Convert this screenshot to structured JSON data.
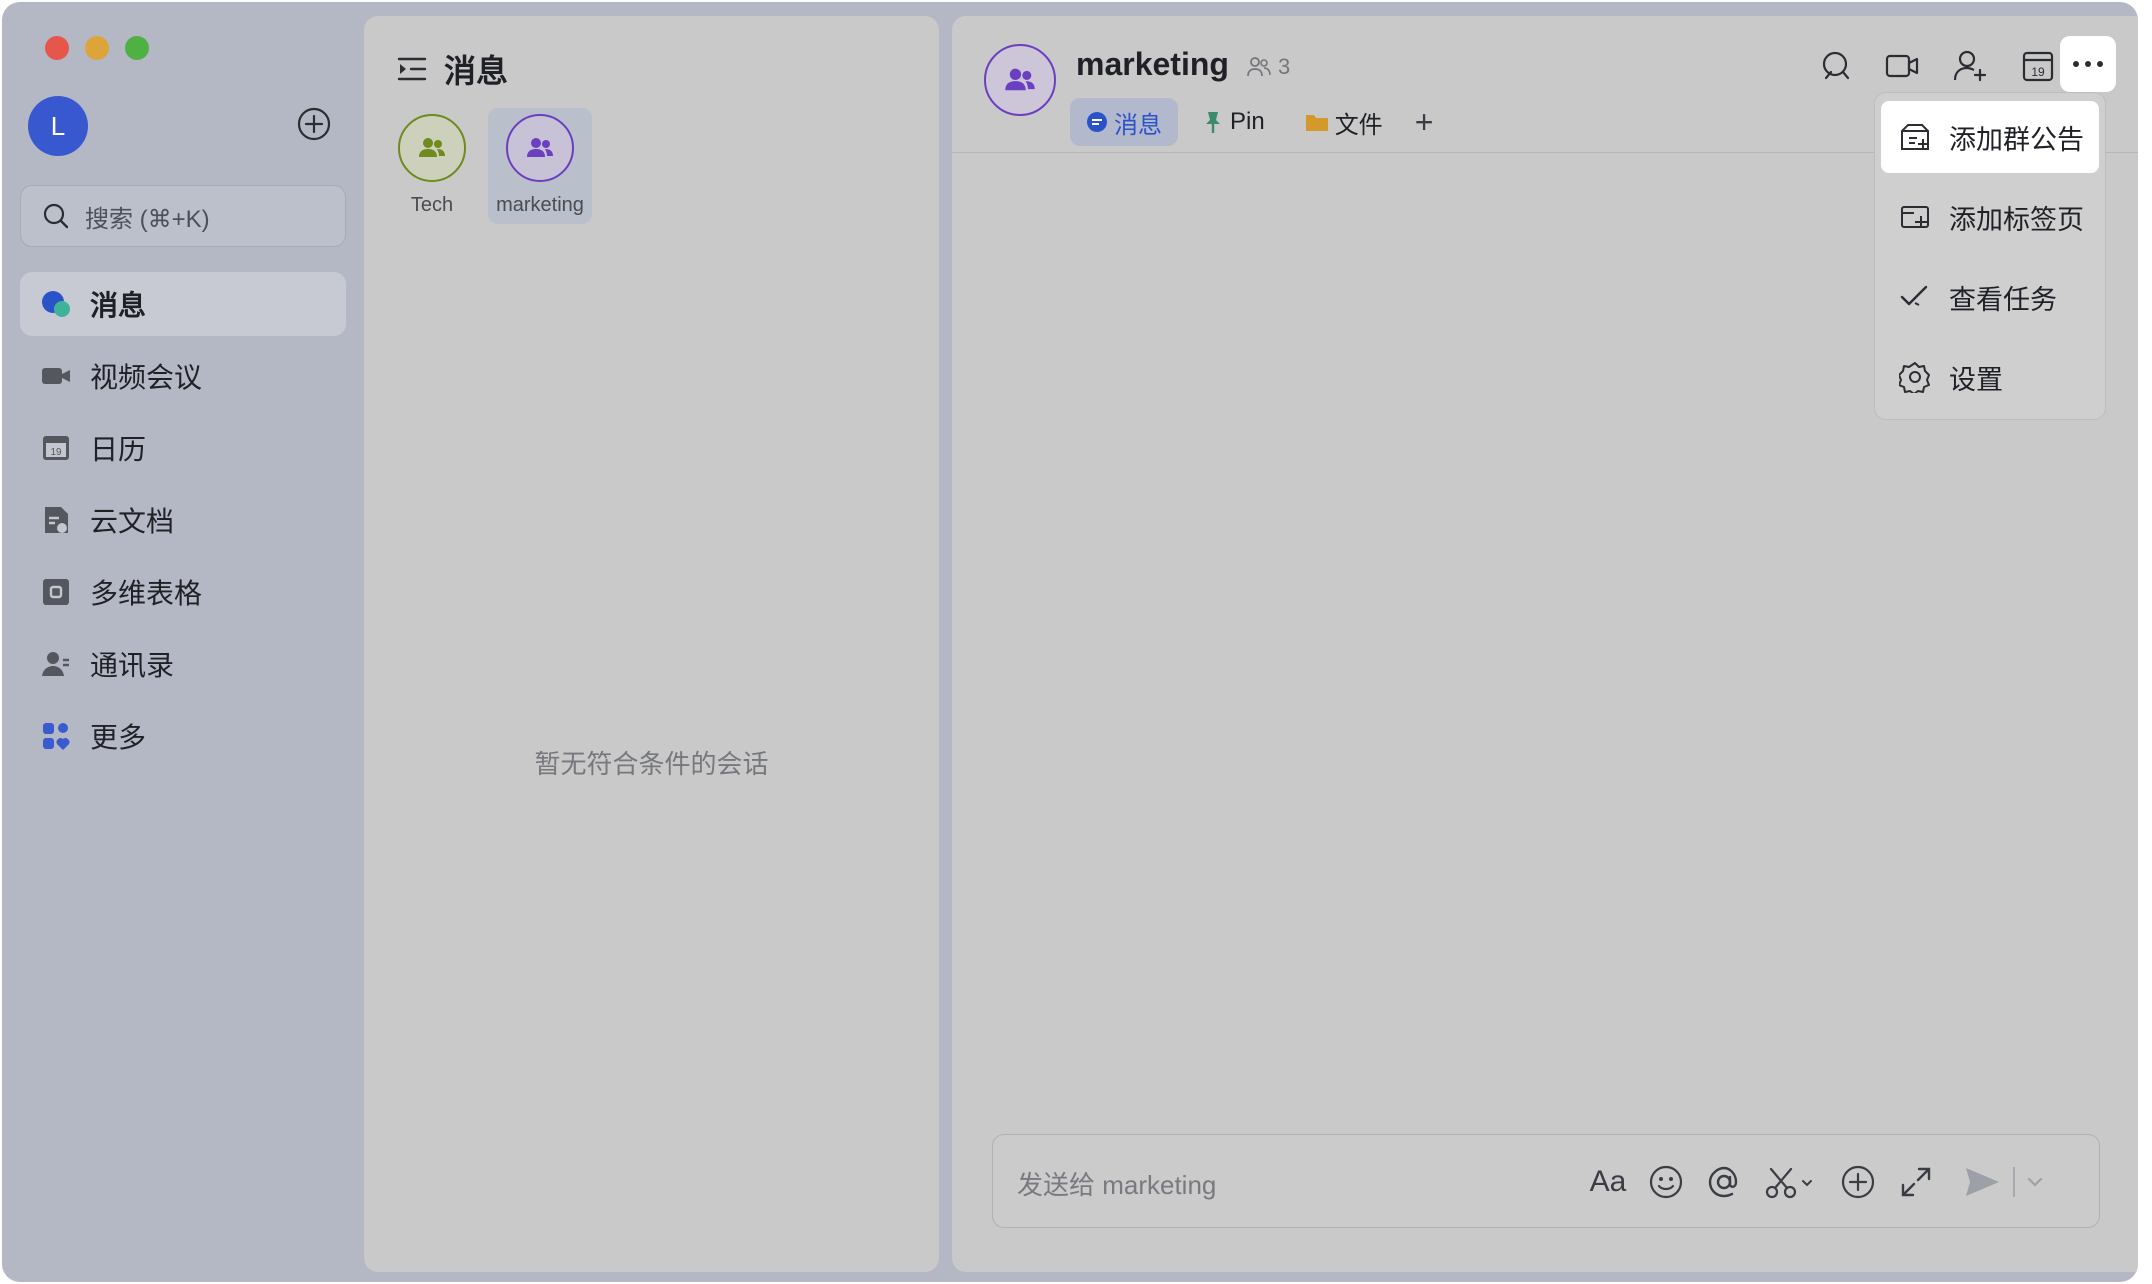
{
  "sidebar": {
    "avatar_initial": "L",
    "search_placeholder": "搜索 (⌘+K)",
    "items": [
      {
        "label": "消息",
        "icon": "chat-bubble-icon",
        "active": true
      },
      {
        "label": "视频会议",
        "icon": "video-camera-icon"
      },
      {
        "label": "日历",
        "icon": "calendar-icon"
      },
      {
        "label": "云文档",
        "icon": "cloud-doc-icon"
      },
      {
        "label": "多维表格",
        "icon": "base-table-icon"
      },
      {
        "label": "通讯录",
        "icon": "contacts-icon"
      },
      {
        "label": "更多",
        "icon": "apps-more-icon"
      }
    ]
  },
  "chat_list": {
    "title": "消息",
    "pinned": [
      {
        "name": "Tech",
        "color": "#6f8a1e"
      },
      {
        "name": "marketing",
        "color": "#6b3fbf",
        "selected": true
      }
    ],
    "empty_text": "暂无符合条件的会话"
  },
  "chat": {
    "title": "marketing",
    "member_count": "3",
    "tabs": [
      {
        "label": "消息",
        "icon": "message-tab-icon",
        "active": true
      },
      {
        "label": "Pin",
        "icon": "pin-icon"
      },
      {
        "label": "文件",
        "icon": "folder-icon"
      }
    ],
    "add_tab": "+",
    "header_icons": [
      "search-icon",
      "video-call-icon",
      "add-member-icon",
      "calendar-icon",
      "more-icon"
    ],
    "composer_placeholder": "发送给 marketing",
    "composer_text_format": "Aa"
  },
  "more_menu": {
    "items": [
      {
        "label": "添加群公告",
        "icon": "announcement-icon",
        "highlighted": true
      },
      {
        "label": "添加标签页",
        "icon": "add-tab-icon"
      },
      {
        "label": "查看任务",
        "icon": "task-check-icon"
      },
      {
        "label": "设置",
        "icon": "gear-icon"
      }
    ]
  },
  "colors": {
    "accent": "#2b53c9",
    "tech_group": "#6f8a1e",
    "marketing_group": "#6b3fbf",
    "close": "#e7564b",
    "minimize": "#dca43a",
    "zoom": "#4fb144"
  }
}
